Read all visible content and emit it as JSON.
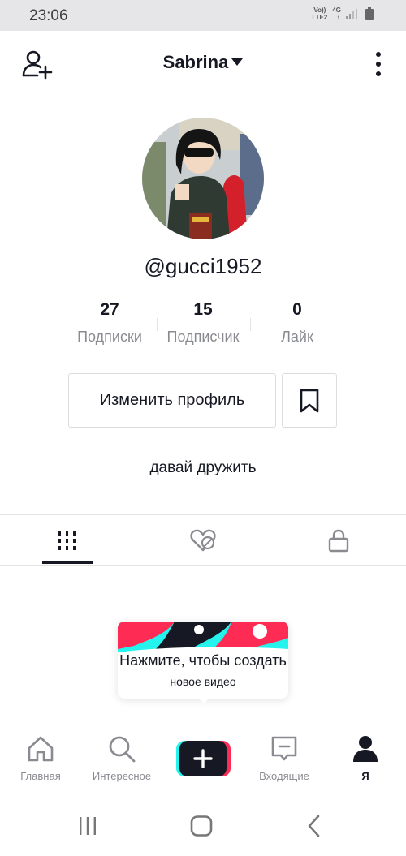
{
  "status_bar": {
    "time": "23:06",
    "net_line1": "Vo))",
    "net_line2": "LTE2",
    "net_type": "4G"
  },
  "header": {
    "username": "Sabrina"
  },
  "profile": {
    "handle": "@gucci1952",
    "bio": "давай дружить",
    "stats": [
      {
        "value": "27",
        "label": "Подписки"
      },
      {
        "value": "15",
        "label": "Подписчик"
      },
      {
        "value": "0",
        "label": "Лайк"
      }
    ],
    "edit_button": "Изменить профиль"
  },
  "tabs": [
    {
      "icon": "grid-icon",
      "active": true
    },
    {
      "icon": "liked-hidden-icon",
      "active": false
    },
    {
      "icon": "lock-icon",
      "active": false
    }
  ],
  "create_prompt": {
    "title": "Нажмите, чтобы создать",
    "subtitle": "новое видео"
  },
  "bottom_nav": [
    {
      "label": "Главная",
      "icon": "home-icon"
    },
    {
      "label": "Интересное",
      "icon": "search-icon"
    },
    {
      "label": "",
      "icon": "plus-icon"
    },
    {
      "label": "Входящие",
      "icon": "inbox-icon"
    },
    {
      "label": "Я",
      "icon": "profile-icon"
    }
  ],
  "colors": {
    "accent_cyan": "#25f4ee",
    "accent_red": "#fe2c55",
    "text_primary": "#161823",
    "text_secondary": "#8a8b91"
  }
}
